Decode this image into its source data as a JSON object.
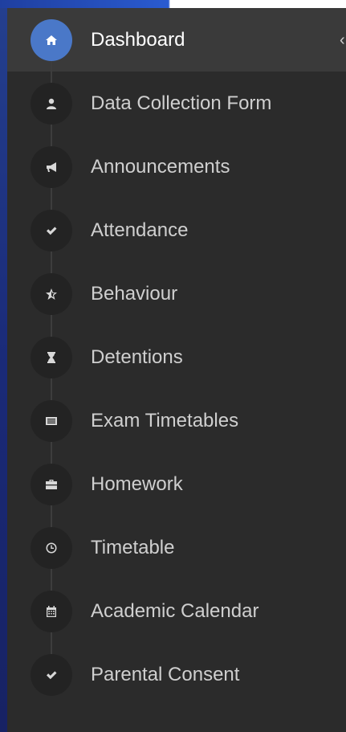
{
  "sidebar": {
    "items": [
      {
        "label": "Dashboard",
        "icon": "home-icon",
        "active": true
      },
      {
        "label": "Data Collection Form",
        "icon": "user-icon"
      },
      {
        "label": "Announcements",
        "icon": "megaphone-icon"
      },
      {
        "label": "Attendance",
        "icon": "check-icon"
      },
      {
        "label": "Behaviour",
        "icon": "star-half-icon"
      },
      {
        "label": "Detentions",
        "icon": "hourglass-icon"
      },
      {
        "label": "Exam Timetables",
        "icon": "list-icon"
      },
      {
        "label": "Homework",
        "icon": "briefcase-icon"
      },
      {
        "label": "Timetable",
        "icon": "clock-icon"
      },
      {
        "label": "Academic Calendar",
        "icon": "calendar-icon"
      },
      {
        "label": "Parental Consent",
        "icon": "check-icon"
      }
    ],
    "caret": "‹"
  },
  "colors": {
    "sidebar_bg": "#2b2b2b",
    "active_bg": "#3a3a3a",
    "active_icon": "#4a78c8",
    "text": "#cfcfcf"
  }
}
